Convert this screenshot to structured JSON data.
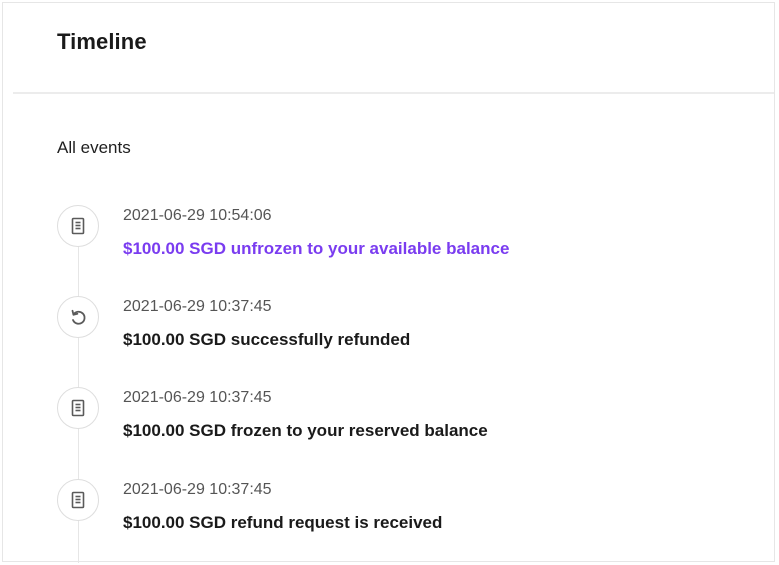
{
  "header": {
    "title": "Timeline"
  },
  "section": {
    "label": "All events"
  },
  "colors": {
    "accent": "#7a3cf0",
    "text": "#1a1a1a",
    "muted": "#555555",
    "border": "#e6e6e6"
  },
  "events": [
    {
      "icon": "document-icon",
      "time": "2021-06-29 10:54:06",
      "description": "$100.00 SGD unfrozen to your available balance",
      "highlighted": true
    },
    {
      "icon": "undo-icon",
      "time": "2021-06-29 10:37:45",
      "description": "$100.00 SGD successfully refunded",
      "highlighted": false
    },
    {
      "icon": "document-icon",
      "time": "2021-06-29 10:37:45",
      "description": "$100.00 SGD frozen to your reserved balance",
      "highlighted": false
    },
    {
      "icon": "document-icon",
      "time": "2021-06-29 10:37:45",
      "description": "$100.00 SGD refund request is received",
      "highlighted": false
    }
  ]
}
